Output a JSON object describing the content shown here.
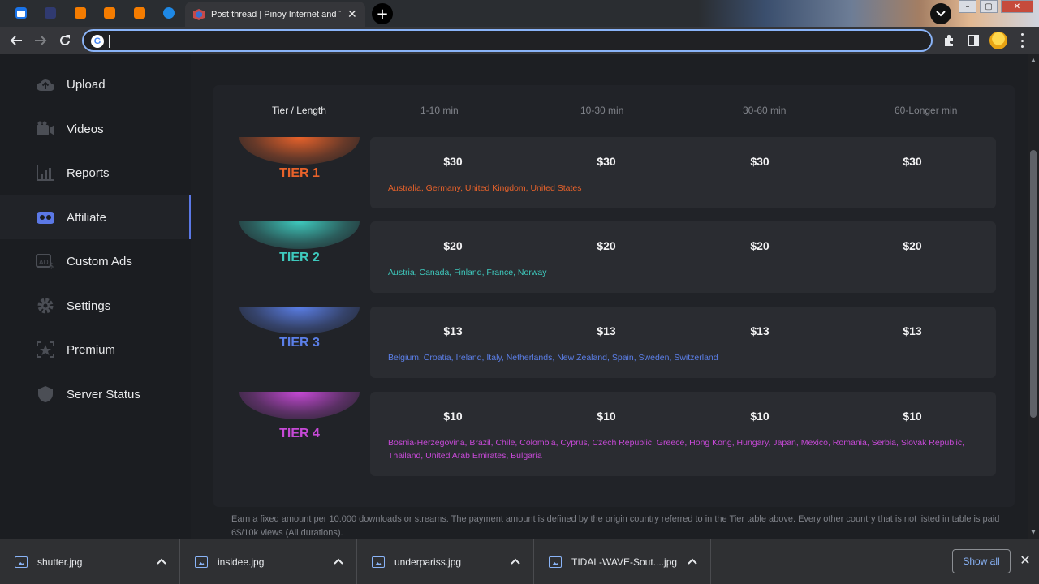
{
  "browser": {
    "tabs": [
      {
        "icon": "calendar-icon",
        "color": "#1a73e8"
      },
      {
        "icon": "site-icon",
        "color": "#303a70"
      },
      {
        "icon": "blogger-icon",
        "color": "#f57c00"
      },
      {
        "icon": "blogger-icon",
        "color": "#f57c00"
      },
      {
        "icon": "blogger-icon",
        "color": "#f57c00"
      },
      {
        "icon": "play-icon",
        "color": "#1e88e5"
      }
    ],
    "active_tab_title": "Post thread | Pinoy Internet and T",
    "new_tab_label": "+",
    "address_value": "",
    "address_placeholder": ""
  },
  "sidebar": {
    "items": [
      {
        "label": "Upload",
        "icon": "upload-icon"
      },
      {
        "label": "Videos",
        "icon": "videos-icon"
      },
      {
        "label": "Reports",
        "icon": "reports-icon"
      },
      {
        "label": "Affiliate",
        "icon": "affiliate-icon",
        "active": true
      },
      {
        "label": "Custom Ads",
        "icon": "custom-ads-icon"
      },
      {
        "label": "Settings",
        "icon": "settings-icon"
      },
      {
        "label": "Premium",
        "icon": "premium-icon"
      },
      {
        "label": "Server Status",
        "icon": "server-status-icon"
      }
    ]
  },
  "table": {
    "header": {
      "tier_length": "Tier / Length",
      "columns": [
        "1-10 min",
        "10-30 min",
        "30-60 min",
        "60-Longer min"
      ]
    },
    "tiers": [
      {
        "name": "TIER 1",
        "color": "#e8622a",
        "prices": [
          "$30",
          "$30",
          "$30",
          "$30"
        ],
        "countries": "Australia, Germany, United Kingdom, United States"
      },
      {
        "name": "TIER 2",
        "color": "#3ec9bd",
        "prices": [
          "$20",
          "$20",
          "$20",
          "$20"
        ],
        "countries": "Austria, Canada, Finland, France, Norway"
      },
      {
        "name": "TIER 3",
        "color": "#5b7fe8",
        "prices": [
          "$13",
          "$13",
          "$13",
          "$13"
        ],
        "countries": "Belgium, Croatia, Ireland, Italy, Netherlands, New Zealand, Spain, Sweden, Switzerland"
      },
      {
        "name": "TIER 4",
        "color": "#c649d6",
        "prices": [
          "$10",
          "$10",
          "$10",
          "$10"
        ],
        "countries": "Bosnia-Herzegovina, Brazil, Chile, Colombia, Cyprus, Czech Republic, Greece, Hong Kong, Hungary, Japan, Mexico, Romania, Serbia, Slovak Republic, Thailand, United Arab Emirates, Bulgaria"
      }
    ]
  },
  "footnote": "Earn a fixed amount per 10.000 downloads or streams. The payment amount is defined by the origin country referred to in the Tier table above. Every other country that is not listed in table is paid 6$/10k views (All durations).",
  "downloads": {
    "items": [
      "shutter.jpg",
      "insidee.jpg",
      "underpariss.jpg",
      "TIDAL-WAVE-Sout....jpg"
    ],
    "show_all": "Show all",
    "close": "✕"
  }
}
